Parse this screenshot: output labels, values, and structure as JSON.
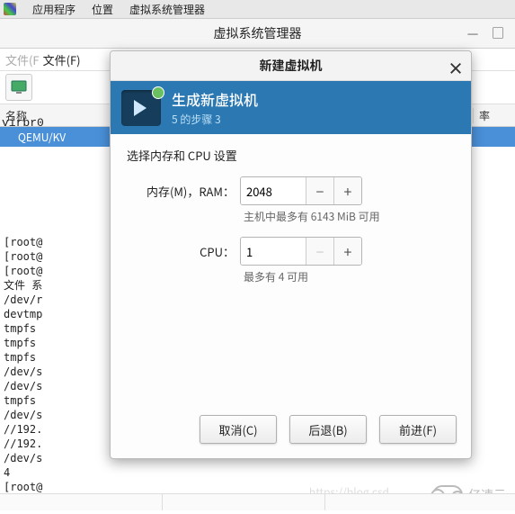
{
  "system_menu": {
    "applications": "应用程序",
    "places": "位置",
    "vmm": "虚拟系统管理器"
  },
  "main_window": {
    "title": "虚拟系统管理器",
    "file_menu_bg": "文件(F",
    "file_menu": "文件(F)",
    "columns": {
      "name": "名称",
      "rate": "率"
    },
    "connection_row": "QEMU/KV"
  },
  "side_text": "virbr0",
  "terminal_lines": "[root@\n[root@\n[root@\n文件 系\n/dev/r\ndevtmp\ntmpfs\ntmpfs\ntmpfs\n/dev/s\n/dev/s\ntmpfs\n/dev/s\n//192.\n//192.\n/dev/s\n4\n[root@",
  "dialog": {
    "title": "新建虚拟机",
    "header_title": "生成新虚拟机",
    "header_subtitle": "5 的步骤 3",
    "section": "选择内存和 CPU 设置",
    "ram_label": "内存(M)，RAM：",
    "ram_value": "2048",
    "ram_hint": "主机中最多有 6143 MiB 可用",
    "cpu_label": "CPU：",
    "cpu_value": "1",
    "cpu_hint": "最多有 4 可用",
    "buttons": {
      "cancel": "取消(C)",
      "back": "后退(B)",
      "forward": "前进(F)"
    }
  },
  "watermark": {
    "url": "https://blog.csd",
    "brand": "亿速云"
  }
}
